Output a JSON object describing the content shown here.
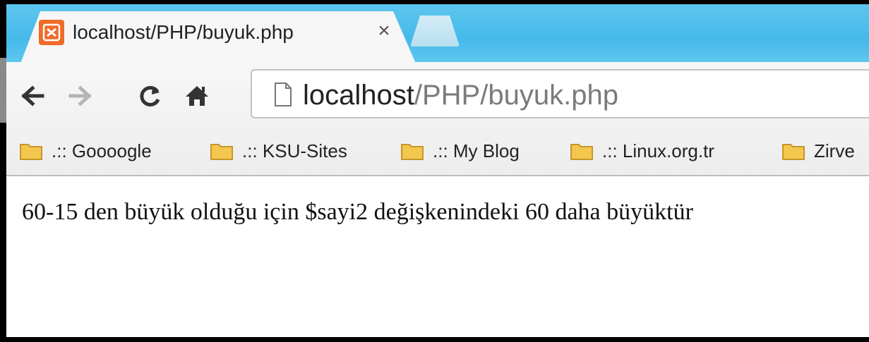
{
  "tab": {
    "title": "localhost/PHP/buyuk.php",
    "close_glyph": "×",
    "favicon": "xampp-icon"
  },
  "nav": {
    "back_icon": "back-arrow-icon",
    "forward_icon": "forward-arrow-icon",
    "reload_icon": "reload-icon",
    "home_icon": "home-icon"
  },
  "omnibox": {
    "host": "localhost",
    "path": "/PHP/buyuk.php"
  },
  "bookmarks": [
    {
      "label": ".:: Goooogle"
    },
    {
      "label": ".:: KSU-Sites"
    },
    {
      "label": ".:: My Blog"
    },
    {
      "label": ".:: Linux.org.tr"
    },
    {
      "label": "Zirve"
    }
  ],
  "page": {
    "text": "60-15 den büyük olduğu için $sayi2 değişkenindeki 60 daha büyüktür"
  },
  "colors": {
    "tabstrip": "#45b9ea",
    "favicon": "#f06b2a",
    "folder": "#f3c74e"
  }
}
